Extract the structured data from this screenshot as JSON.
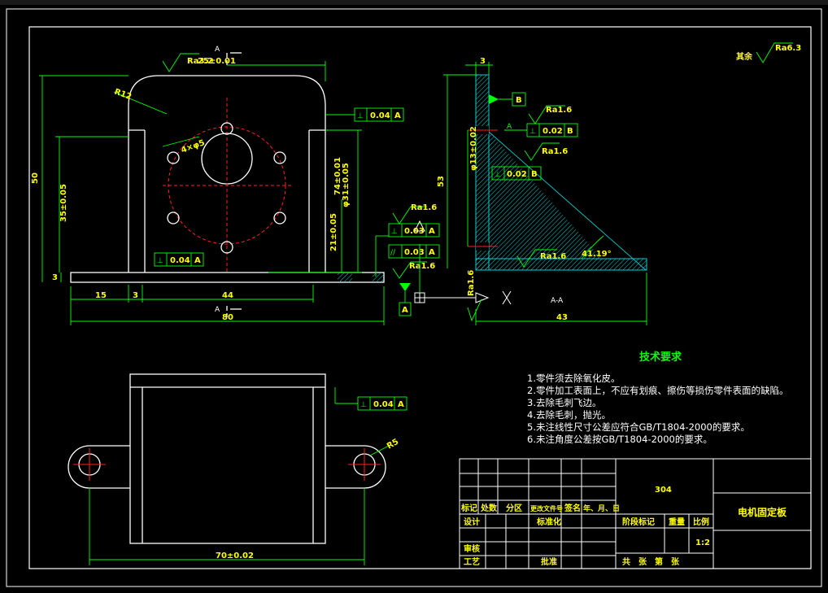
{
  "drawing": {
    "section_mark": "A",
    "section_view_label": "A-A",
    "roughness_other": "其余",
    "roughness_other_value": "Ra6.3",
    "roughness_values": [
      "Ra3.2",
      "Ra1.6",
      "Ra1.6",
      "Ra1.6",
      "Ra1.6",
      "Ra1.6",
      "Ra1.6"
    ],
    "dims": {
      "top_width": "25±0.01",
      "height_total": "50",
      "height_inner": "35±0.05",
      "base": "3",
      "left": "15",
      "mid": "3",
      "center_span": "44",
      "overall": "80",
      "radius": "R12",
      "hole": "4×φ5",
      "v1": "74±0.01",
      "v2": "φ31±0.05",
      "v3": "21±0.05",
      "side_height": "53",
      "side_top": "3",
      "side_hole": "φ13±0.02",
      "side_width": "43",
      "angle": "41.19°",
      "plan_width": "70±0.02",
      "plan_radius": "R5"
    },
    "tolerances": [
      {
        "sym": "⊥",
        "val": "0.04",
        "ref": "A"
      },
      {
        "sym": "⊥",
        "val": "0.04",
        "ref": "A"
      },
      {
        "sym": "⊥",
        "val": "0.02",
        "ref": "B"
      },
      {
        "sym": "⊥",
        "val": "0.02",
        "ref": "B"
      },
      {
        "sym": "⊥",
        "val": "0.03",
        "ref": "A"
      },
      {
        "sym": "//",
        "val": "0.03",
        "ref": "A"
      },
      {
        "sym": "⊥",
        "val": "0.04",
        "ref": "A"
      }
    ],
    "datums": [
      "A",
      "B"
    ]
  },
  "tech_req": {
    "title": "技术要求",
    "items": [
      "1.零件须去除氧化皮。",
      "2.零件加工表面上，不应有划痕、擦伤等损伤零件表面的缺陷。",
      "3.去除毛刺飞边。",
      "4.去除毛刺，抛光。",
      "5.未注线性尺寸公差应符合GB/T1804-2000的要求。",
      "6.未注角度公差按GB/T1804-2000的要求。"
    ]
  },
  "title_block": {
    "material": "304",
    "part_name": "电机固定板",
    "row_labels": [
      "标记",
      "处数",
      "分区",
      "更改文件号",
      "签名",
      "年、月、日"
    ],
    "design": "设计",
    "standard": "标准化",
    "stage_mark": "阶段标记",
    "weight": "重量",
    "scale": "比例",
    "scale_value": "1:2",
    "review": "审核",
    "process": "工艺",
    "approve": "批准",
    "sheets": "共　张　第　张"
  }
}
